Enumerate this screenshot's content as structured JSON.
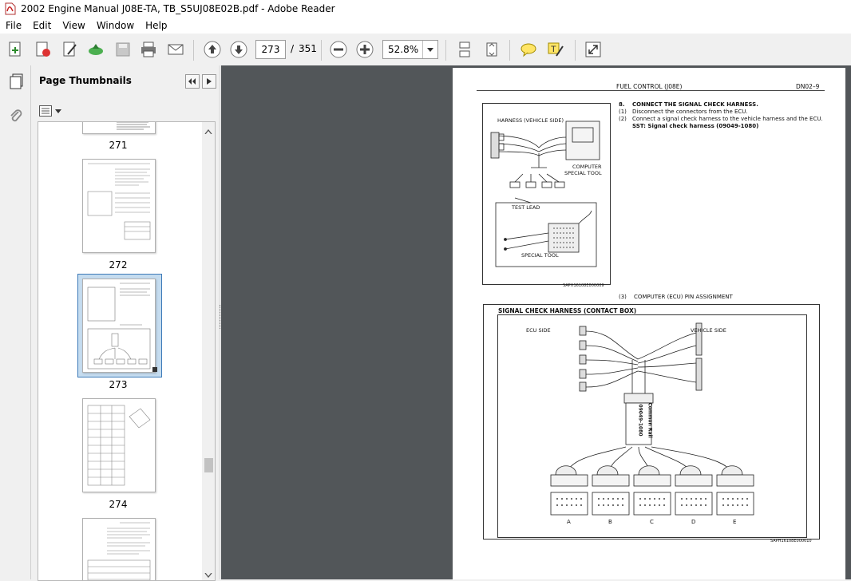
{
  "window": {
    "title": "2002 Engine Manual J08E-TA, TB_S5UJ08E02B.pdf - Adobe Reader"
  },
  "menu": [
    "File",
    "Edit",
    "View",
    "Window",
    "Help"
  ],
  "toolbar": {
    "page_current": "273",
    "page_separator": "/",
    "page_total": "351",
    "zoom": "52.8%"
  },
  "panel": {
    "title": "Page Thumbnails",
    "thumbnails": [
      {
        "label": "271"
      },
      {
        "label": "272"
      },
      {
        "label": "273",
        "selected": true
      },
      {
        "label": "274"
      }
    ]
  },
  "doc_page": {
    "header_section": "FUEL CONTROL (J08E)",
    "header_code": "DN02–9",
    "step_number": "8.",
    "step_title": "CONNECT THE SIGNAL CHECK HARNESS.",
    "sub1_num": "(1)",
    "sub1": "Disconnect the connectors from the ECU.",
    "sub2_num": "(2)",
    "sub2": "Connect a signal check harness to the vehicle harness and the ECU.",
    "sst": "SST:  Signal check harness  (09049-1080)",
    "sub3_num": "(3)",
    "sub3": "COMPUTER (ECU) PIN ASSIGNMENT",
    "fig1": {
      "harness_label": "HARNESS (VEHICLE SIDE)",
      "computer_label": "COMPUTER",
      "special_tool_label": "SPECIAL TOOL",
      "test_lead_label": "TEST LEAD",
      "special_tool_label2": "SPECIAL TOOL",
      "code": "SAPH16108E000009"
    },
    "fig2": {
      "title": "SIGNAL CHECK HARNESS (CONTACT BOX)",
      "ecu_side": "ECU SIDE",
      "vehicle_side": "VEHICLE SIDE",
      "box_label_1": "09049-1080",
      "box_label_2": "Common Rail",
      "connectors": [
        "A",
        "B",
        "C",
        "D",
        "E"
      ],
      "code": "SAPH16108E000010"
    }
  },
  "colors": {
    "viewer_bg": "#525659",
    "selection": "#c5dcef",
    "selection_border": "#3d7ab8"
  }
}
